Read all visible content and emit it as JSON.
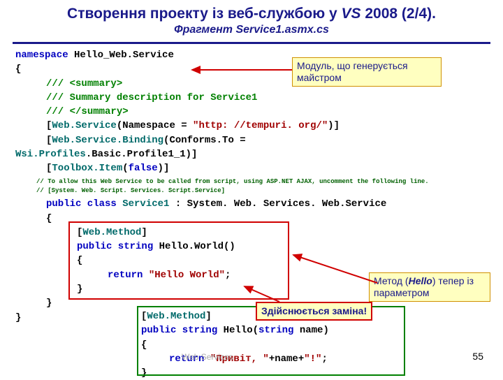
{
  "title_pre": "Створення проекту із веб-службою у ",
  "title_em": "VS",
  "title_post": " 2008 (2/4).",
  "subtitle": "Фрагмент Service1.asmx.cs",
  "callout1_l1": "Модуль, що генерується",
  "callout1_l2": "майстром",
  "callout2_l1": "Метод (",
  "callout2_em": "Hello",
  "callout2_l1b": ") тепер із",
  "callout2_l2": "параметром",
  "callout3": "Здійснюється заміна!",
  "code": {
    "l1a": "namespace",
    "l1b": " Hello_Web.Service",
    "l2": "{",
    "l3a": "/// ",
    "l3b": "<summary>",
    "l4a": "/// ",
    "l4b": "Summary description for Service1",
    "l5a": "/// ",
    "l5b": "</summary>",
    "l6a": "[",
    "l6b": "Web.Service",
    "l6c": "(Namespace = ",
    "l6d": "\"http: //tempuri. org/\"",
    "l6e": ")]",
    "l7a": "[",
    "l7b": "Web.Service.Binding",
    "l7c": "(Conforms.To =",
    "l8a": "Wsi.Profiles",
    "l8b": ".Basic.Profile1_1)]",
    "l9a": "[",
    "l9b": "Toolbox.Item",
    "l9c": "(",
    "l9d": "false",
    "l9e": ")]",
    "sc1": "// To allow this Web Service to be called from script, using ASP.NET AJAX, uncomment the following line.",
    "sc2": "// [System. Web. Script. Services. Script.Service]",
    "l10a": "public class ",
    "l10b": "Service1",
    "l10c": " : System. Web. Services. Web.Service",
    "l11": "{",
    "l12a": "[",
    "l12b": "Web.Method",
    "l12c": "]",
    "l13a": "public string",
    "l13b": " Hello.World()",
    "l14": "{",
    "l15a": "return ",
    "l15b": "\"Hello World\"",
    "l15c": ";",
    "l16": "}",
    "l17": "}",
    "l18": "}",
    "r1a": "[",
    "r1b": "Web.Method",
    "r1c": "]",
    "r2a": "public string",
    "r2b": " Hello(",
    "r2c": "string",
    "r2d": " name)",
    "r3": "{",
    "r4a": "return ",
    "r4b": "\"Привіт, \"",
    "r4c": "+name+",
    "r4d": "\"!\"",
    "r4e": ";",
    "r5": "}"
  },
  "footer": "Web Services",
  "pagenum": "55"
}
